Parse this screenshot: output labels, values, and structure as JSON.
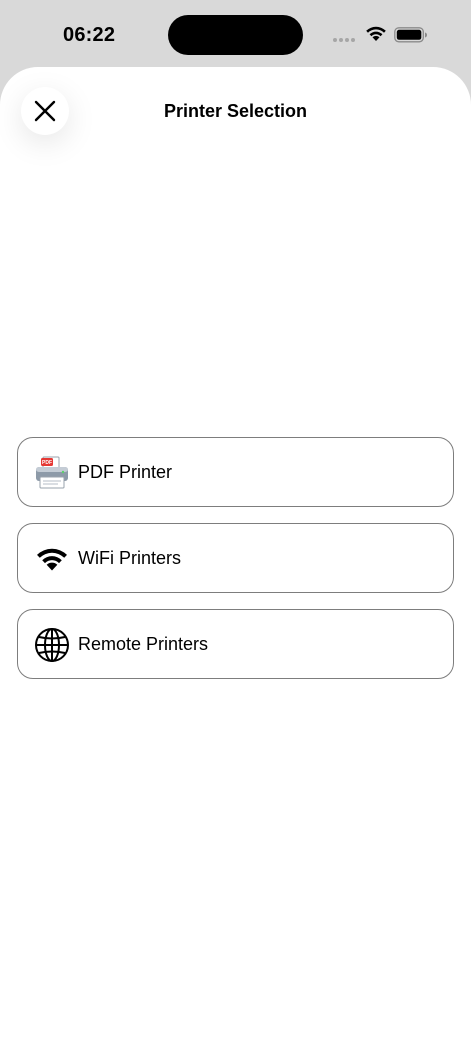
{
  "status_bar": {
    "time": "06:22",
    "icons": [
      "cellular-signal-icon",
      "wifi-icon",
      "battery-icon"
    ]
  },
  "sheet": {
    "title": "Printer Selection",
    "close_icon": "close-icon"
  },
  "options": [
    {
      "label": "PDF Printer",
      "icon": "pdf-printer-icon"
    },
    {
      "label": "WiFi Printers",
      "icon": "wifi-icon"
    },
    {
      "label": "Remote Printers",
      "icon": "globe-icon"
    }
  ],
  "colors": {
    "background": "#d9d9d9",
    "sheet": "#ffffff",
    "border": "#7d7d7d",
    "text": "#000000",
    "pdf_badge": "#e53935"
  }
}
